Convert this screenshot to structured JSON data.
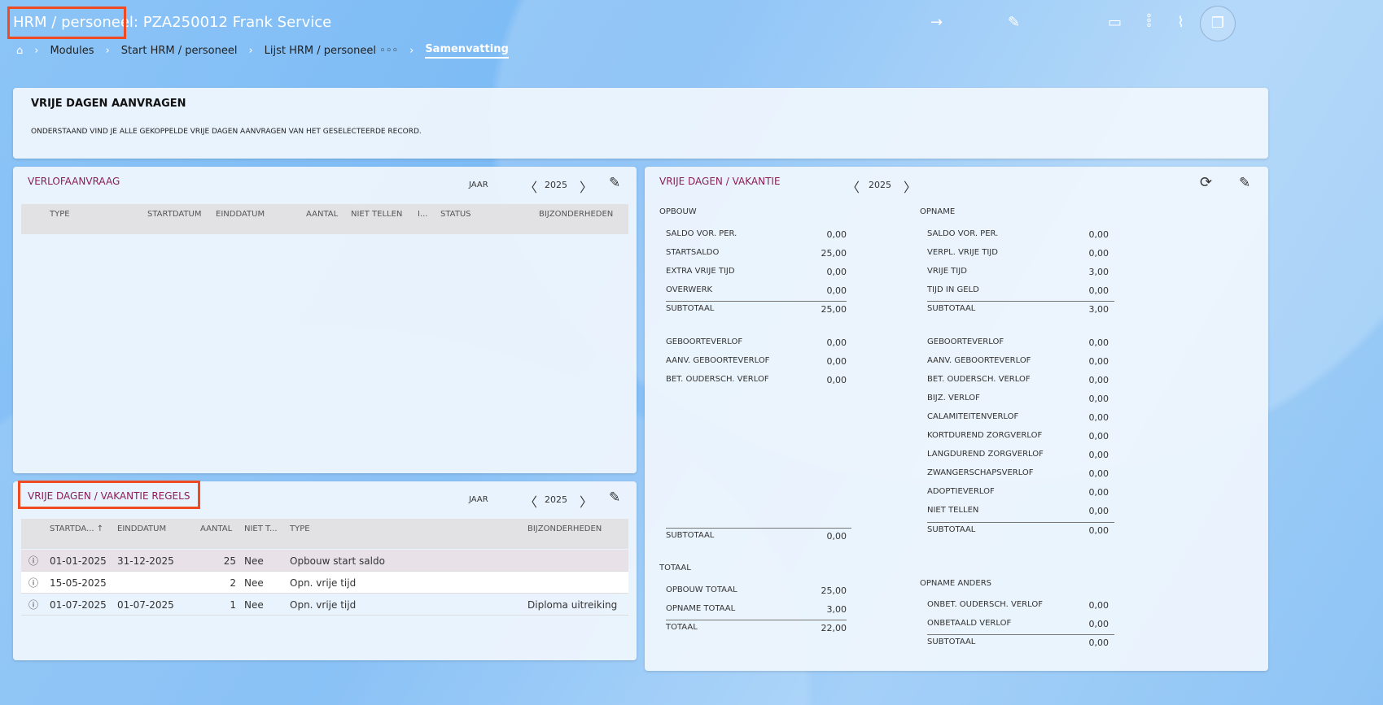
{
  "header": {
    "title_prefix": "HRM / personeel",
    "title_suffix": ": PZA250012 Frank Service"
  },
  "breadcrumb": [
    "Modules",
    "Start HRM / personeel",
    "Lijst HRM / personeel ◦◦◦",
    "Samenvatting"
  ],
  "icons": [
    "arrow-right-icon",
    "pencil-icon",
    "monitor-icon",
    "more-vertical-icon",
    "paperclip-icon",
    "document-copy-icon"
  ],
  "info": {
    "title": "VRIJE DAGEN AANVRAGEN",
    "text": "ONDERSTAAND VIND JE ALLE GEKOPPELDE VRIJE DAGEN AANVRAGEN VAN HET GESELECTEERDE RECORD."
  },
  "verlof": {
    "title": "VERLOFAANVRAAG",
    "year_label": "JAAR",
    "year": "2025",
    "columns": [
      "TYPE",
      "STARTDATUM",
      "EINDDATUM",
      "AANTAL",
      "NIET TELLEN",
      "I...",
      "STATUS",
      "BIJZONDERHEDEN"
    ]
  },
  "regels": {
    "title": "VRIJE DAGEN / VAKANTIE REGELS",
    "year_label": "JAAR",
    "year": "2025",
    "columns": [
      "STARTDA...",
      "EINDDATUM",
      "AANTAL",
      "NIET T...",
      "TYPE",
      "BIJZONDERHEDEN"
    ],
    "rows": [
      {
        "start": "01-01-2025",
        "end": "31-12-2025",
        "aantal": "25",
        "niet": "Nee",
        "type": "Opbouw start saldo",
        "bijz": ""
      },
      {
        "start": "15-05-2025",
        "end": "",
        "aantal": "2",
        "niet": "Nee",
        "type": "Opn. vrije tijd",
        "bijz": ""
      },
      {
        "start": "01-07-2025",
        "end": "01-07-2025",
        "aantal": "1",
        "niet": "Nee",
        "type": "Opn. vrije tijd",
        "bijz": "Diploma uitreiking"
      }
    ]
  },
  "vakantie": {
    "title": "VRIJE DAGEN / VAKANTIE",
    "year": "2025",
    "opbouw": {
      "title": "OPBOUW",
      "rows": [
        [
          "SALDO VOR. PER.",
          "0,00"
        ],
        [
          "STARTSALDO",
          "25,00"
        ],
        [
          "EXTRA VRIJE TIJD",
          "0,00"
        ],
        [
          "OVERWERK",
          "0,00"
        ]
      ],
      "subtotal_label": "SUBTOTAAL",
      "subtotal": "25,00",
      "rows2": [
        [
          "GEBOORTEVERLOF",
          "0,00"
        ],
        [
          "AANV. GEBOORTEVERLOF",
          "0,00"
        ],
        [
          "BET. OUDERSCH. VERLOF",
          "0,00"
        ]
      ],
      "subtotal2_label": "SUBTOTAAL",
      "subtotal2": "0,00"
    },
    "opname": {
      "title": "OPNAME",
      "rows": [
        [
          "SALDO VOR. PER.",
          "0,00"
        ],
        [
          "VERPL. VRIJE TIJD",
          "0,00"
        ],
        [
          "VRIJE TIJD",
          "3,00"
        ],
        [
          "TIJD IN GELD",
          "0,00"
        ]
      ],
      "subtotal_label": "SUBTOTAAL",
      "subtotal": "3,00",
      "rows2": [
        [
          "GEBOORTEVERLOF",
          "0,00"
        ],
        [
          "AANV. GEBOORTEVERLOF",
          "0,00"
        ],
        [
          "BET. OUDERSCH. VERLOF",
          "0,00"
        ],
        [
          "BIJZ. VERLOF",
          "0,00"
        ],
        [
          "CALAMITEITENVERLOF",
          "0,00"
        ],
        [
          "KORTDUREND ZORGVERLOF",
          "0,00"
        ],
        [
          "LANGDUREND ZORGVERLOF",
          "0,00"
        ],
        [
          "ZWANGERSCHAPSVERLOF",
          "0,00"
        ],
        [
          "ADOPTIEVERLOF",
          "0,00"
        ],
        [
          "NIET TELLEN",
          "0,00"
        ]
      ],
      "subtotal2_label": "SUBTOTAAL",
      "subtotal2": "0,00"
    },
    "totaal": {
      "title": "TOTAAL",
      "rows": [
        [
          "OPBOUW TOTAAL",
          "25,00"
        ],
        [
          "OPNAME TOTAAL",
          "3,00"
        ]
      ],
      "total_label": "TOTAAL",
      "total": "22,00"
    },
    "anders": {
      "title": "OPNAME ANDERS",
      "rows": [
        [
          "ONBET. OUDERSCH. VERLOF",
          "0,00"
        ],
        [
          "ONBETAALD VERLOF",
          "0,00"
        ]
      ],
      "subtotal_label": "SUBTOTAAL",
      "subtotal": "0,00"
    }
  },
  "colors": {
    "accent_title": "#8a1e55",
    "highlight": "#f04a23"
  }
}
